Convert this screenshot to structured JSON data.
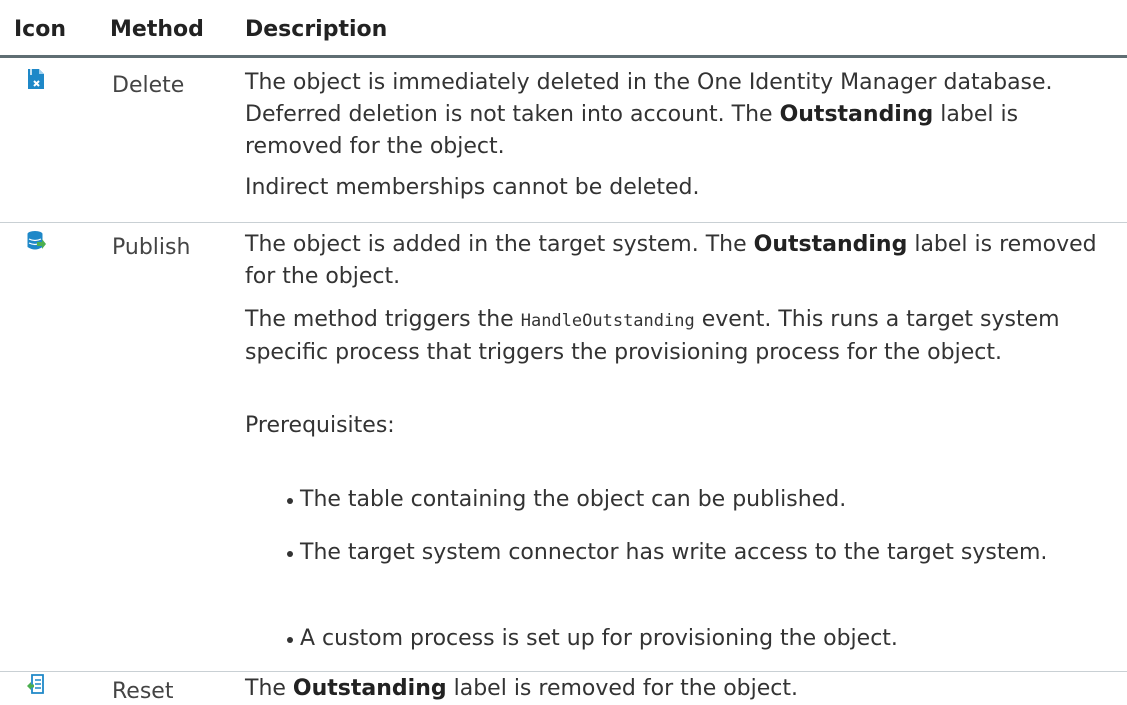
{
  "header": {
    "icon": "Icon",
    "method": "Method",
    "description": "Description"
  },
  "rows": [
    {
      "icon": "delete-icon",
      "method": "Delete",
      "paragraphs": [
        {
          "pre": "The object is immediately deleted in the One Identity Manager database. Deferred deletion is not taken into account. The ",
          "bold": "Outstanding",
          "post": " label is removed for the object."
        },
        {
          "text": "Indirect memberships cannot be deleted."
        }
      ]
    },
    {
      "icon": "publish-icon",
      "method": "Publish",
      "paragraphs": [
        {
          "pre": "The object is added in the target system. The ",
          "bold": "Outstanding",
          "post": " label is removed for the object."
        },
        {
          "pre": "The method triggers the ",
          "code": "HandleOutstanding",
          "post": " event. This runs a target system specific process that triggers the provisioning process for the object."
        },
        {
          "text": "Prerequisites:"
        }
      ],
      "bullets": [
        "The table containing the object can be published.",
        "The target system connector has write access to the target system.",
        "A custom process is set up for provisioning the object."
      ]
    },
    {
      "icon": "reset-icon",
      "method": "Reset",
      "paragraphs": [
        {
          "pre": "The ",
          "bold": "Outstanding",
          "post": " label is removed for the object."
        }
      ]
    }
  ],
  "colors": {
    "header_rule": "#5f6e73",
    "row_rule": "#c9d0d4",
    "icon_blue": "#1e88c8",
    "icon_green": "#4caf50"
  }
}
